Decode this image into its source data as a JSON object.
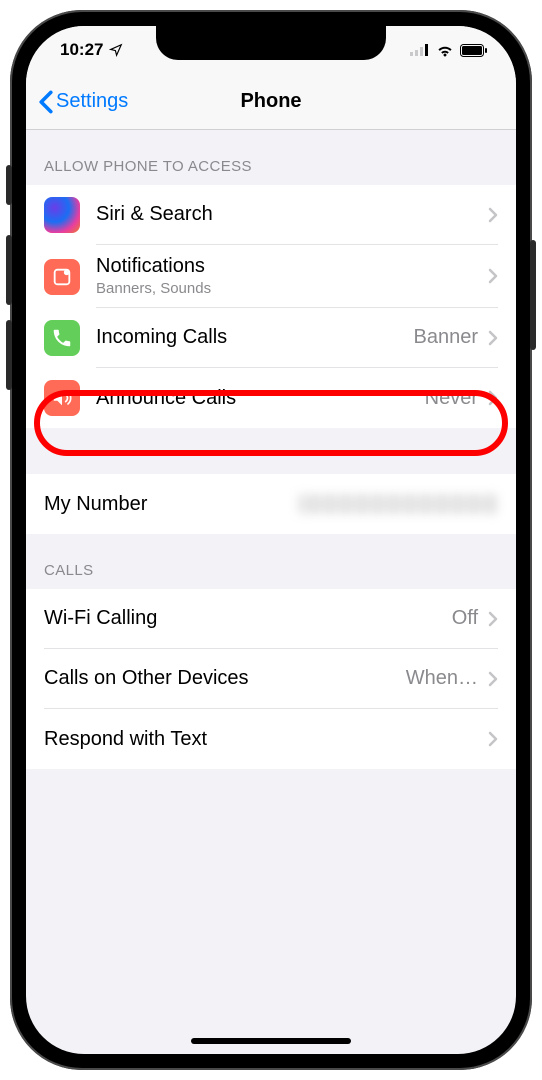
{
  "status": {
    "time": "10:27",
    "location_glyph": "➤"
  },
  "nav": {
    "back_label": "Settings",
    "title": "Phone"
  },
  "sections": {
    "access_header": "Allow Phone to Access",
    "calls_header": "Calls"
  },
  "rows": {
    "siri": {
      "label": "Siri & Search"
    },
    "notifications": {
      "label": "Notifications",
      "sub": "Banners, Sounds"
    },
    "incoming": {
      "label": "Incoming Calls",
      "value": "Banner"
    },
    "announce": {
      "label": "Announce Calls",
      "value": "Never"
    },
    "my_number": {
      "label": "My Number"
    },
    "wifi_calling": {
      "label": "Wi-Fi Calling",
      "value": "Off"
    },
    "other_devices": {
      "label": "Calls on Other Devices",
      "value": "When…"
    },
    "respond_text": {
      "label": "Respond with Text"
    }
  },
  "colors": {
    "notification_icon": "#ff6b57",
    "incoming_icon": "#63cf5a",
    "announce_icon": "#ff6b57",
    "accent": "#007aff",
    "highlight": "#ff0000"
  }
}
